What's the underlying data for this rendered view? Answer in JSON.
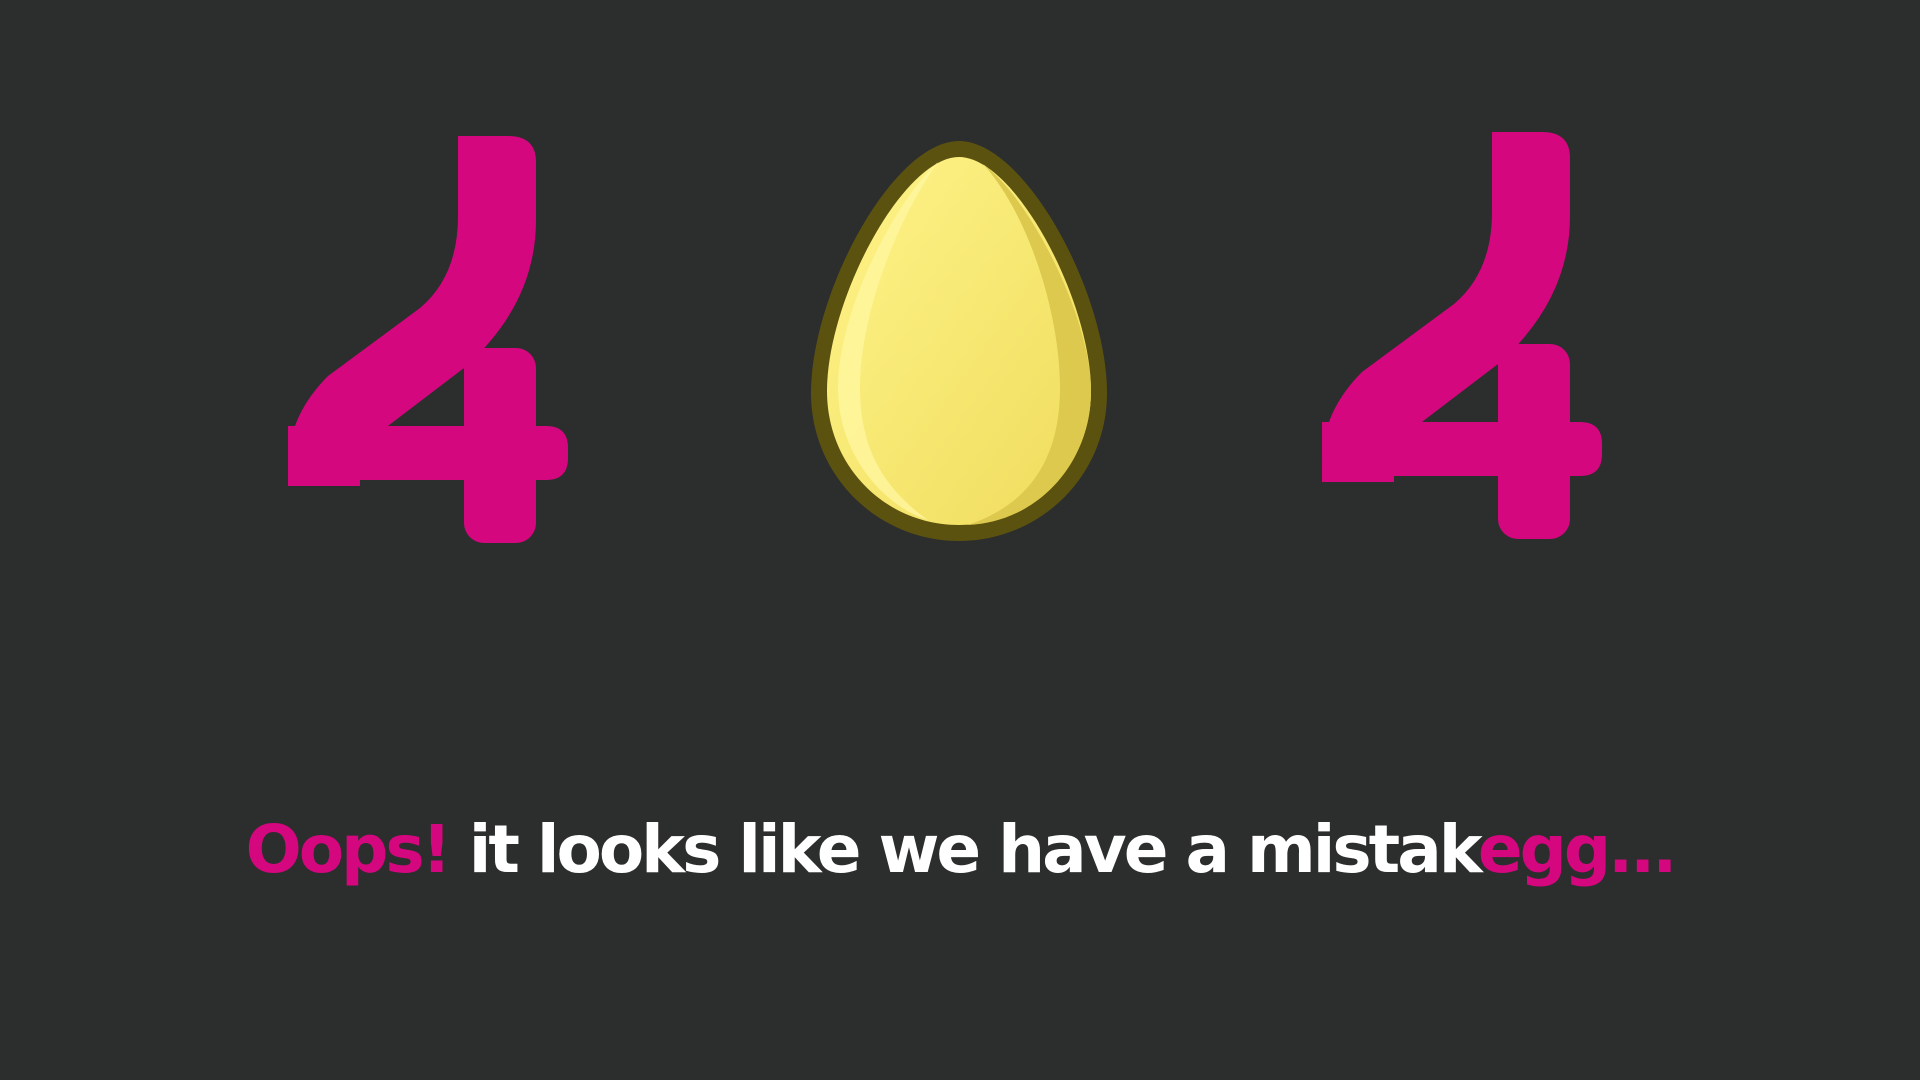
{
  "error": {
    "code_digits": [
      "4",
      "4"
    ],
    "center_icon": "egg-icon"
  },
  "message": {
    "prefix": "Oops!",
    "middle": " it looks like we have a mistak",
    "suffix": "egg..."
  },
  "colors": {
    "background": "#2c2d2d",
    "accent": "#d4077f",
    "text": "#ffffff",
    "egg_fill": "#f6e66a",
    "egg_outline": "#5c5210"
  }
}
